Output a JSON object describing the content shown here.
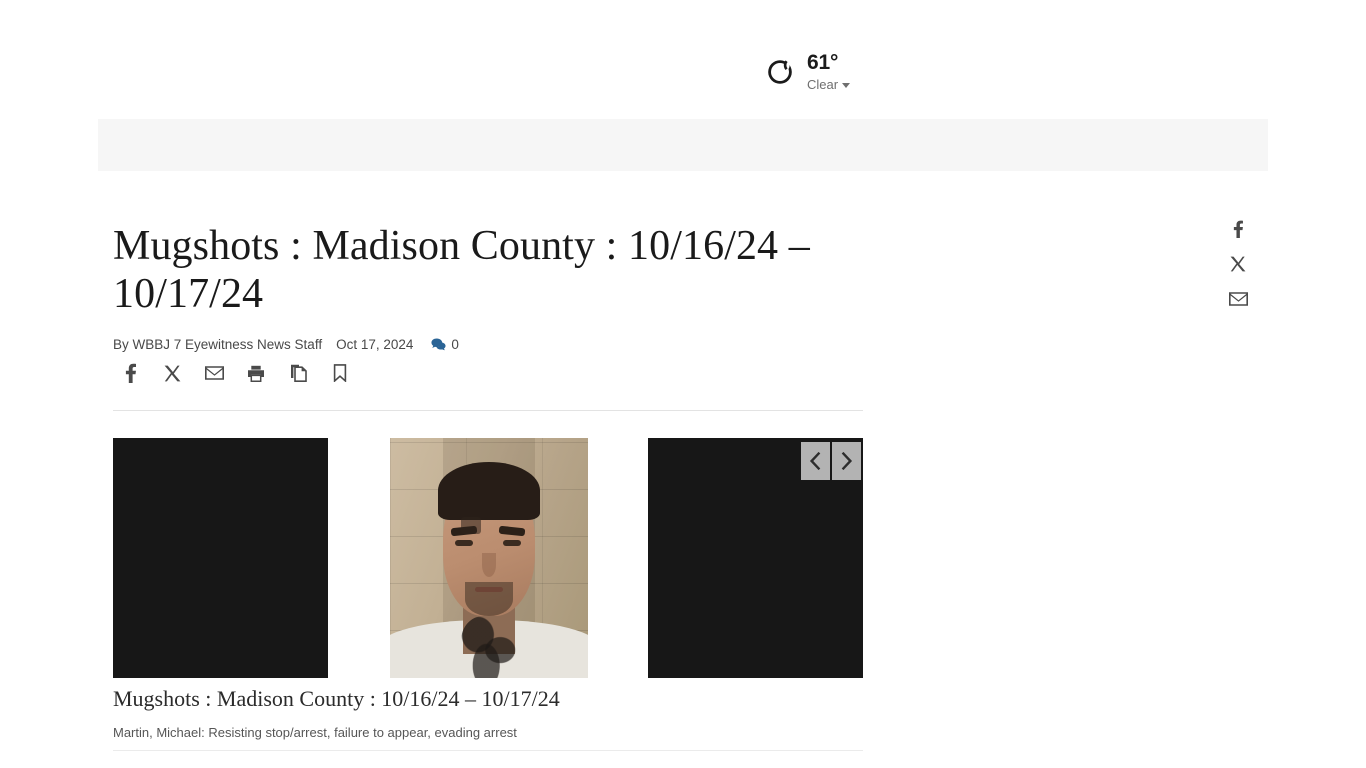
{
  "weather": {
    "icon": "crescent-moon-icon",
    "temperature": "61°",
    "condition": "Clear",
    "caret": "chevron-down-icon"
  },
  "banner": {
    "label": ""
  },
  "article": {
    "headline": "Mugshots : Madison County : 10/16/24 – 10/17/24",
    "byline_author": "By WBBJ 7 Eyewitness News Staff",
    "byline_date": "Oct 17, 2024",
    "comment_count": "0",
    "comment_icon": "comment-bubble-icon"
  },
  "share_bar": {
    "items": [
      {
        "name": "facebook-icon",
        "label": "Facebook"
      },
      {
        "name": "x-twitter-icon",
        "label": "X"
      },
      {
        "name": "email-icon",
        "label": "Email"
      },
      {
        "name": "print-icon",
        "label": "Print"
      },
      {
        "name": "copy-icon",
        "label": "Copy link"
      },
      {
        "name": "bookmark-icon",
        "label": "Save"
      }
    ]
  },
  "share_rail": {
    "items": [
      {
        "name": "facebook-icon",
        "label": "Facebook"
      },
      {
        "name": "x-twitter-icon",
        "label": "X"
      },
      {
        "name": "email-icon",
        "label": "Email"
      }
    ]
  },
  "gallery": {
    "prev_label": "‹",
    "next_label": "›",
    "caption_title": "Mugshots : Madison County : 10/16/24 – 10/17/24",
    "caption_desc": "Martin, Michael: Resisting stop/arrest, failure to appear, evading arrest",
    "slides": [
      {
        "name": "slide-previous",
        "alt": ""
      },
      {
        "name": "slide-current",
        "alt": "Martin, Michael mugshot"
      },
      {
        "name": "slide-next",
        "alt": ""
      }
    ]
  },
  "colors": {
    "page_background": "#ffffff",
    "banner": "#f6f6f6",
    "headline_text": "#1a1a1a",
    "byline_text": "#494949",
    "link_accent": "#2a6496",
    "icon_grey": "#4a4a4a",
    "nav_button": "#b3b3b3",
    "slide_dark": "#171717",
    "divider": "#e3e3e3"
  }
}
